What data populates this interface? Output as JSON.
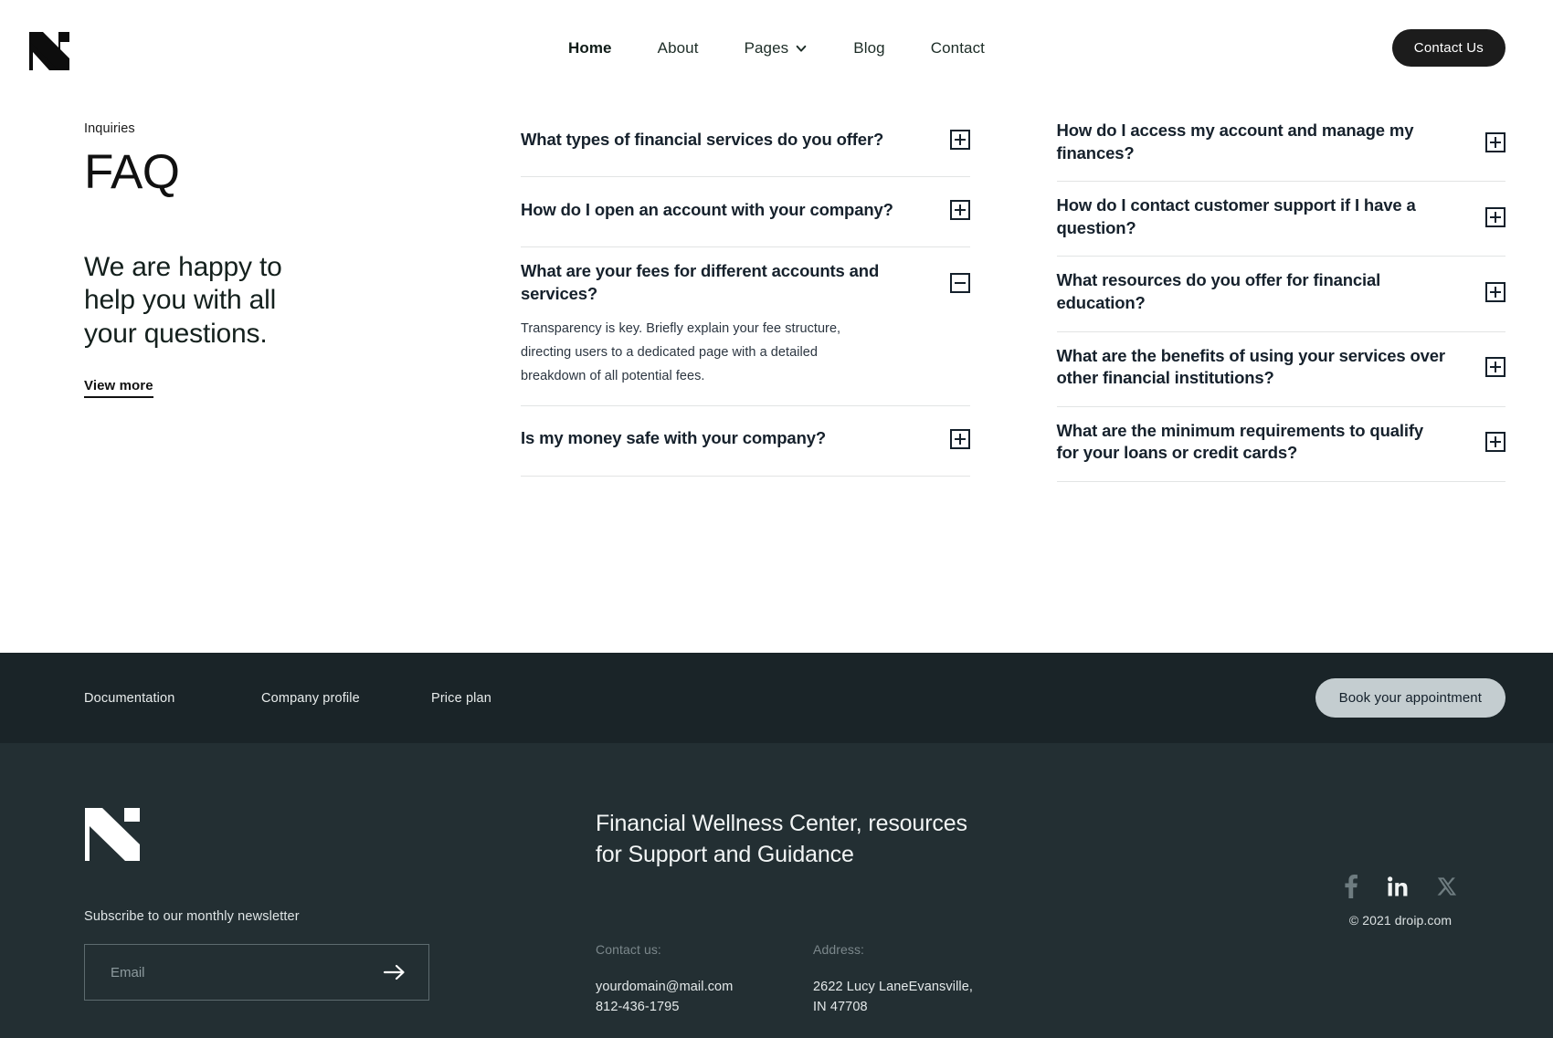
{
  "header": {
    "logo_alt": "droip-logo",
    "nav": [
      {
        "label": "Home",
        "active": true,
        "has_dropdown": false
      },
      {
        "label": "About",
        "active": false,
        "has_dropdown": false
      },
      {
        "label": "Pages",
        "active": false,
        "has_dropdown": true
      },
      {
        "label": "Blog",
        "active": false,
        "has_dropdown": false
      },
      {
        "label": "Contact",
        "active": false,
        "has_dropdown": false
      }
    ],
    "cta_label": "Contact Us"
  },
  "intro": {
    "eyebrow": "Inquiries",
    "title": "FAQ",
    "lead": "We are happy to help you with all your questions.",
    "link_label": "View more"
  },
  "faq": {
    "left_column": [
      {
        "question": "What types of financial services do you offer?",
        "open": false,
        "answer": ""
      },
      {
        "question": "How do I open an account with your company?",
        "open": false,
        "answer": ""
      },
      {
        "question": "What are your fees for different accounts and services?",
        "open": true,
        "answer": "Transparency is key. Briefly explain your fee structure,  directing users to a dedicated page with a detailed breakdown of all potential fees."
      },
      {
        "question": "Is my money safe with your company?",
        "open": false,
        "answer": ""
      }
    ],
    "right_column": [
      {
        "question": "How do I access my account and manage my finances?",
        "open": false,
        "answer": ""
      },
      {
        "question": "How do I contact customer support if I have a question?",
        "open": false,
        "answer": ""
      },
      {
        "question": "What resources do you offer for financial education?",
        "open": false,
        "answer": ""
      },
      {
        "question": "What are the benefits of using your services over other financial institutions?",
        "open": false,
        "answer": ""
      },
      {
        "question": "What are the minimum requirements to qualify for your loans or credit cards?",
        "open": false,
        "answer": ""
      }
    ]
  },
  "band": {
    "links": [
      {
        "label": "Documentation"
      },
      {
        "label": "Company profile"
      },
      {
        "label": "Price plan"
      }
    ],
    "cta_label": "Book your appointment"
  },
  "footer": {
    "subscribe_label": "Subscribe to our monthly newsletter",
    "email_placeholder": "Email",
    "email_value": "",
    "submit_icon": "arrow-right-icon",
    "headline": "Financial Wellness Center, resources for Support and Guidance",
    "contact": {
      "label": "Contact us:",
      "email": "yourdomain@mail.com",
      "phone": "812-436-1795"
    },
    "address": {
      "label": "Address:",
      "line1": "2622 Lucy LaneEvansville,",
      "line2": "IN 47708"
    },
    "socials": [
      {
        "name": "facebook-icon"
      },
      {
        "name": "linkedin-icon"
      },
      {
        "name": "x-twitter-icon"
      }
    ],
    "copyright": "© 2021 droip.com"
  },
  "colors": {
    "band_bg": "#1a2428",
    "footer_bg": "#232f33",
    "dark_button": "#1c1c1c",
    "light_button": "#c4cdd0",
    "text_dark": "#16212c",
    "divider": "#e2e4e4"
  }
}
